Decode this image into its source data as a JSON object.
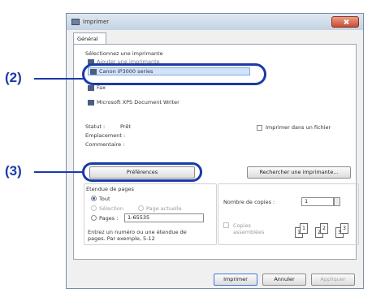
{
  "window": {
    "title": "Imprimer",
    "tab": "Général"
  },
  "printer_section": {
    "heading": "Sélectionnez une imprimante",
    "items": [
      {
        "label": "Ajouter une imprimante"
      },
      {
        "label": "Canon iP3000 series"
      },
      {
        "label": "Fax"
      },
      {
        "label": "Microsoft XPS Document Writer"
      }
    ]
  },
  "status": {
    "status_label": "Statut :",
    "status_value": "Prêt",
    "location_label": "Emplacement :",
    "comment_label": "Commentaire :"
  },
  "print_to_file_label": "Imprimer dans un fichier",
  "buttons": {
    "preferences": "Préférences",
    "find_printer": "Rechercher une imprimante...",
    "print": "Imprimer",
    "cancel": "Annuler",
    "apply": "Appliquer"
  },
  "page_range": {
    "heading": "Étendue de pages",
    "all": "Tout",
    "selection": "Sélection",
    "current_page": "Page actuelle",
    "pages": "Pages :",
    "pages_value": "1-65535",
    "help_text_line1": "Entrez un numéro ou une étendue de",
    "help_text_line2": "pages. Par exemple, 5-12"
  },
  "copies": {
    "label": "Nombre de copies :",
    "value": "1",
    "collate_label_line1": "Copies",
    "collate_label_line2": "assemblées",
    "collate_digits": [
      "1",
      "1",
      "2",
      "2",
      "3",
      "3"
    ]
  },
  "callouts": {
    "step2": "(2)",
    "step3": "(3)"
  },
  "colors": {
    "callout": "#1a3aa8",
    "selection_bg": "#cfe3fb"
  }
}
